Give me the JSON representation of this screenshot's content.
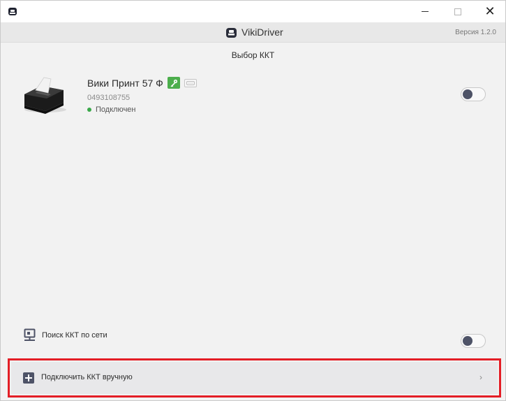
{
  "window": {
    "controls": {
      "minimize": "minimize-icon",
      "maximize": "maximize-icon",
      "close": "close-icon"
    }
  },
  "header": {
    "app_name": "VikiDriver",
    "version": "Версия 1.2.0"
  },
  "main": {
    "section_title": "Выбор ККТ",
    "device": {
      "name": "Вики Принт 57 Ф",
      "serial": "0493108755",
      "status": "Подключен",
      "status_color": "#3aa84a",
      "license_icon": "key-icon",
      "port_icon": "serial-port-icon",
      "toggle_on": false
    },
    "network_search": {
      "label": "Поиск ККТ по сети",
      "icon": "network-icon",
      "toggle_on": false
    },
    "manual_connect": {
      "label": "Подключить ККТ вручную",
      "icon": "plus-icon",
      "highlight_color": "#e31e26"
    }
  },
  "colors": {
    "accent_dark": "#4e5367",
    "license_green": "#4cae4c",
    "background": "#f2f2f2"
  }
}
